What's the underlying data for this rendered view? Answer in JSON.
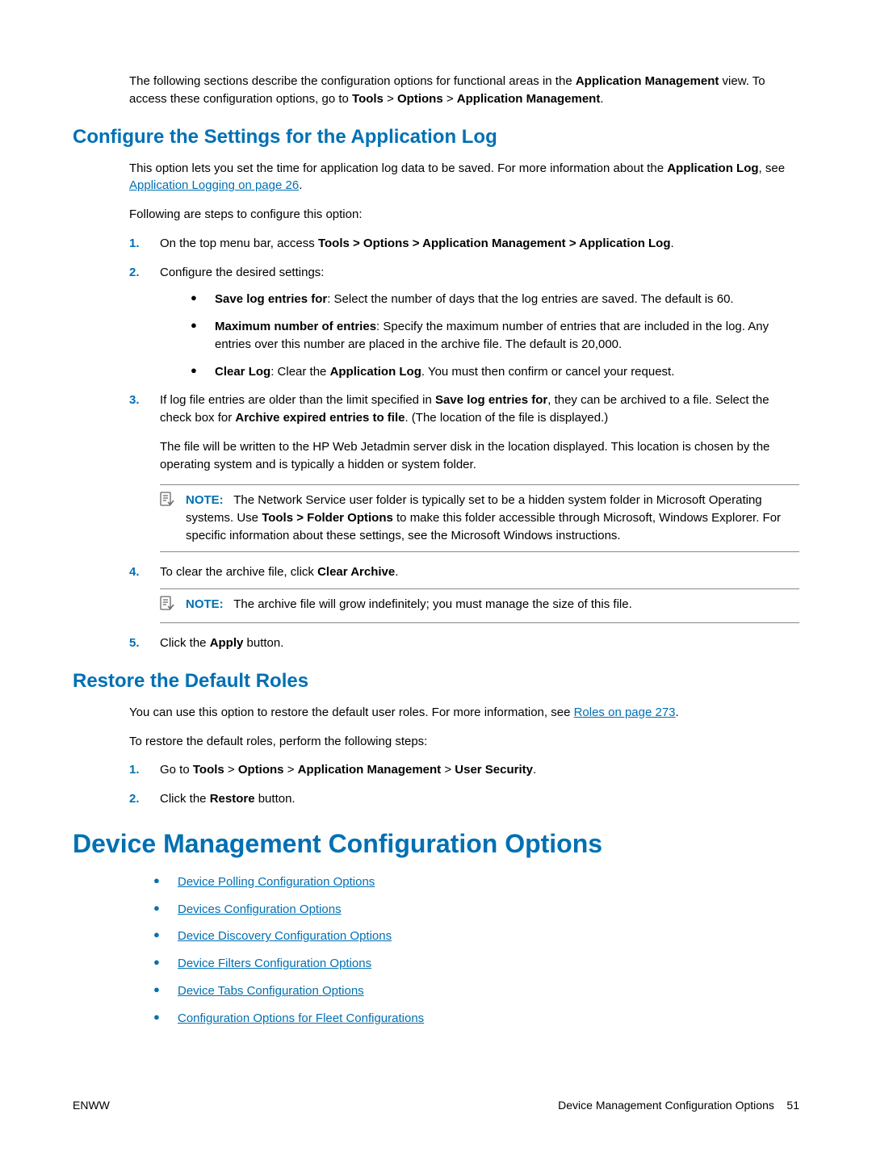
{
  "intro": {
    "prefix": "The following sections describe the configuration options for functional areas in the ",
    "app_mgmt": "Application Management",
    "middle": " view. To access these configuration options, go to ",
    "tools": "Tools",
    "gt1": " > ",
    "options": "Options",
    "gt2": " > ",
    "app_mgmt2": "Application Management",
    "period": "."
  },
  "section1": {
    "title": "Configure the Settings for the Application Log",
    "p1_prefix": "This option lets you set the time for application log data to be saved. For more information about the ",
    "p1_bold": "Application Log",
    "p1_mid": ", see ",
    "p1_link": "Application Logging on page 26",
    "p1_suffix": ".",
    "p2": "Following are steps to configure this option:",
    "steps": {
      "s1_prefix": "On the top menu bar, access ",
      "s1_bold": "Tools > Options > Application Management > Application Log",
      "s1_suffix": ".",
      "s2": "Configure the desired settings:",
      "s2_b1_bold": "Save log entries for",
      "s2_b1_text": ": Select the number of days that the log entries are saved. The default is 60.",
      "s2_b2_bold": "Maximum number of entries",
      "s2_b2_text": ": Specify the maximum number of entries that are included in the log. Any entries over this number are placed in the archive file. The default is 20,000.",
      "s2_b3_bold1": "Clear Log",
      "s2_b3_mid": ": Clear the ",
      "s2_b3_bold2": "Application Log",
      "s2_b3_suffix": ". You must then confirm or cancel your request.",
      "s3_prefix": "If log file entries are older than the limit specified in ",
      "s3_bold1": "Save log entries for",
      "s3_mid": ", they can be archived to a file. Select the check box for ",
      "s3_bold2": "Archive expired entries to file",
      "s3_suffix": ". (The location of the file is displayed.)",
      "s3_p2": "The file will be written to the HP Web Jetadmin server disk in the location displayed. This location is chosen by the operating system and is typically a hidden or system folder.",
      "note1_label": "NOTE:",
      "note1_prefix": "The Network Service user folder is typically set to be a hidden system folder in Microsoft Operating systems. Use ",
      "note1_bold": "Tools > Folder Options",
      "note1_suffix": " to make this folder accessible through Microsoft, Windows Explorer. For specific information about these settings, see the Microsoft Windows instructions.",
      "s4_prefix": "To clear the archive file, click ",
      "s4_bold": "Clear Archive",
      "s4_suffix": ".",
      "note2_label": "NOTE:",
      "note2_text": "The archive file will grow indefinitely; you must manage the size of this file.",
      "s5_prefix": "Click the ",
      "s5_bold": "Apply",
      "s5_suffix": " button."
    }
  },
  "section2": {
    "title": "Restore the Default Roles",
    "p1_prefix": "You can use this option to restore the default user roles. For more information, see ",
    "p1_link": "Roles on page 273",
    "p1_suffix": ".",
    "p2": "To restore the default roles, perform the following steps:",
    "s1_prefix": "Go to ",
    "s1_b1": "Tools",
    "s1_gt": " > ",
    "s1_b2": "Options",
    "s1_b3": "Application Management",
    "s1_b4": "User Security",
    "s1_suffix": ".",
    "s2_prefix": "Click the ",
    "s2_bold": "Restore",
    "s2_suffix": " button."
  },
  "section3": {
    "title": "Device Management Configuration Options",
    "links": [
      "Device Polling Configuration Options",
      "Devices Configuration Options",
      "Device Discovery Configuration Options",
      "Device Filters Configuration Options",
      "Device Tabs Configuration Options",
      "Configuration Options for Fleet Configurations"
    ]
  },
  "footer": {
    "left": "ENWW",
    "right_text": "Device Management Configuration Options",
    "page_num": "51"
  },
  "markers": {
    "m1": "1.",
    "m2": "2.",
    "m3": "3.",
    "m4": "4.",
    "m5": "5."
  }
}
